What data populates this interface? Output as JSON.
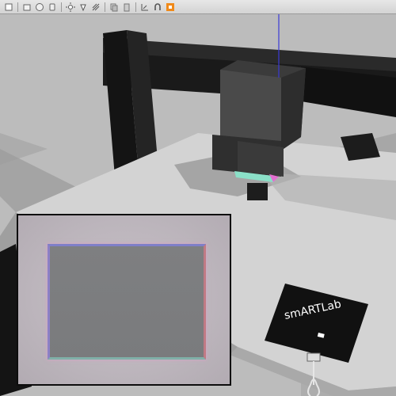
{
  "toolbar": {
    "icons": [
      "select-icon",
      "box-icon",
      "sphere-icon",
      "cylinder-icon",
      "sun-light-icon",
      "spot-light-icon",
      "directional-light-icon",
      "copy-icon",
      "paste-icon",
      "align-icon",
      "magnet-icon",
      "record-icon"
    ]
  },
  "scene": {
    "logo": "smARTLab"
  },
  "colors": {
    "floor": "#b9b9b9",
    "frame": "#171717",
    "plate": "#d1d1d1",
    "head": "#3a3a3a",
    "accent": "#f08a1a"
  }
}
